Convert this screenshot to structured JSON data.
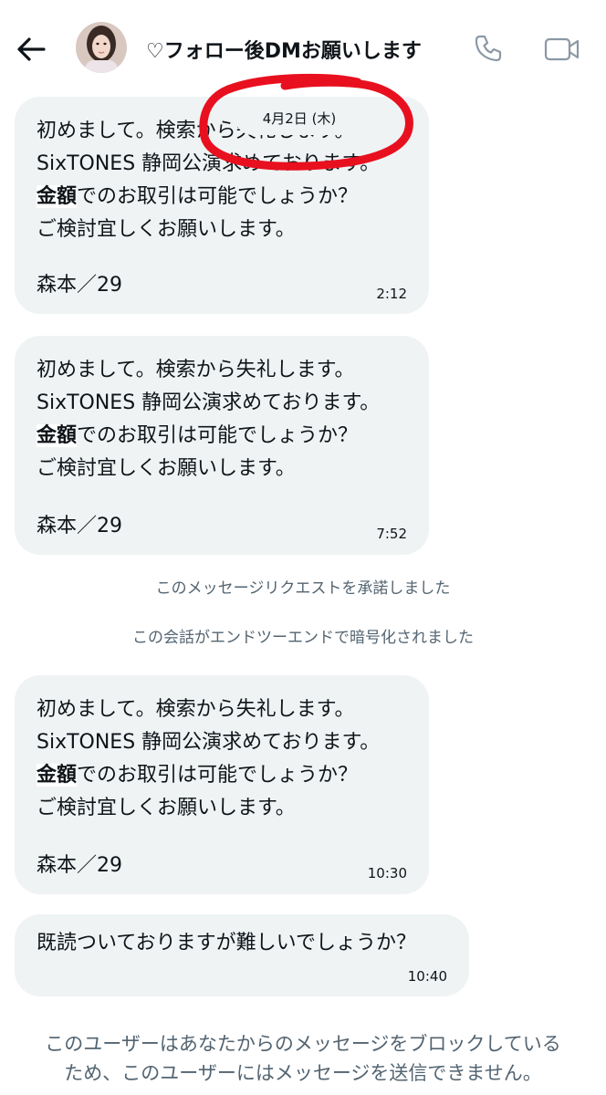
{
  "header": {
    "title": "♡フォロー後DMお願いします",
    "back_icon": "arrow-left-icon",
    "phone_icon": "phone-icon",
    "video_icon": "video-camera-icon"
  },
  "date_chip": "4月2日 (木)",
  "messages": [
    {
      "lines": [
        "初めまして。検索から失礼します。",
        "SixTONES 静岡公演求めております。",
        "でのお取引は可能でしょうか？",
        "ご検討宜しくお願いします。"
      ],
      "bold": "金額",
      "sign": "森本／29",
      "time": "2:12"
    },
    {
      "lines": [
        "初めまして。検索から失礼します。",
        "SixTONES 静岡公演求めております。",
        "でのお取引は可能でしょうか？",
        "ご検討宜しくお願いします。"
      ],
      "bold": "金額",
      "sign": "森本／29",
      "time": "7:52"
    },
    {
      "lines": [
        "初めまして。検索から失礼します。",
        "SixTONES 静岡公演求めております。",
        "でのお取引は可能でしょうか？",
        "ご検討宜しくお願いします。"
      ],
      "bold": "金額",
      "sign": "森本／29",
      "time": "10:30"
    },
    {
      "text": "既読ついておりますが難しいでしょうか？",
      "time": "10:40"
    }
  ],
  "system": {
    "accepted": "このメッセージリクエストを承諾しました",
    "encrypted": "この会話がエンドツーエンドで暗号化されました"
  },
  "blocked": {
    "line1": "このユーザーはあなたからのメッセージをブロックしている",
    "line2": "ため、このユーザーにはメッセージを送信できません。"
  },
  "colors": {
    "bubble": "#eff3f4",
    "muted_text": "#536471",
    "annotation": "#e8101f"
  }
}
